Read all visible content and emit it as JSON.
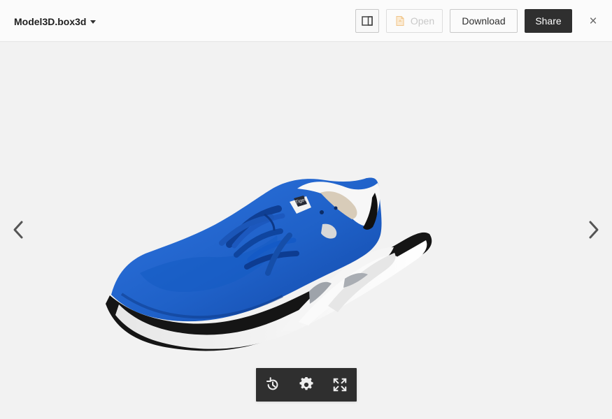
{
  "header": {
    "file_name": "Model3D.box3d",
    "open_label": "Open",
    "download_label": "Download",
    "share_label": "Share"
  },
  "viewer": {
    "toolbar_icons": [
      "history-icon",
      "settings-icon",
      "fullscreen-icon"
    ],
    "nav_icons": [
      "chevron-left-icon",
      "chevron-right-icon"
    ]
  },
  "colors": {
    "topbar_bg": "#fbfbfb",
    "viewer_bg": "#f2f2f2",
    "share_bg": "#2f2f2f",
    "toolbar_bg": "#2f2f2f",
    "shoe_blue": "#1e5fc6"
  }
}
